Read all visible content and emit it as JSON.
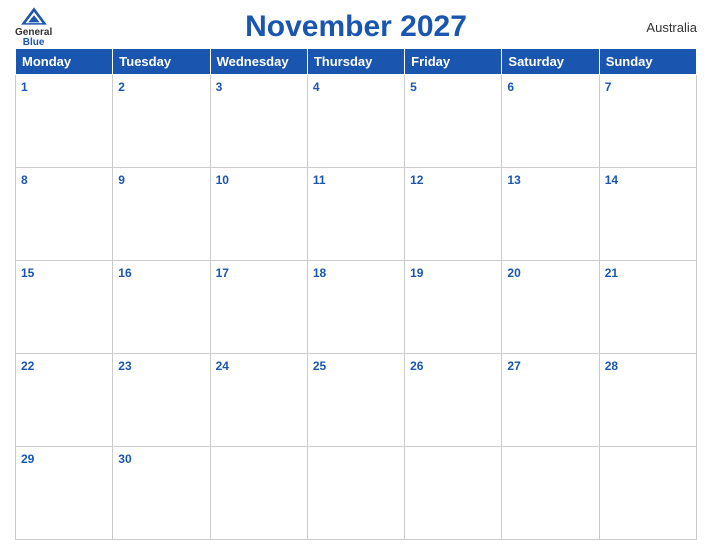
{
  "header": {
    "title": "November 2027",
    "country": "Australia",
    "logo": {
      "line1": "General",
      "line2": "Blue"
    }
  },
  "weekdays": [
    "Monday",
    "Tuesday",
    "Wednesday",
    "Thursday",
    "Friday",
    "Saturday",
    "Sunday"
  ],
  "weeks": [
    [
      1,
      2,
      3,
      4,
      5,
      6,
      7
    ],
    [
      8,
      9,
      10,
      11,
      12,
      13,
      14
    ],
    [
      15,
      16,
      17,
      18,
      19,
      20,
      21
    ],
    [
      22,
      23,
      24,
      25,
      26,
      27,
      28
    ],
    [
      29,
      30,
      null,
      null,
      null,
      null,
      null
    ]
  ],
  "colors": {
    "header_bg": "#1a56b0",
    "header_text": "#ffffff",
    "day_number": "#1a56b0"
  }
}
